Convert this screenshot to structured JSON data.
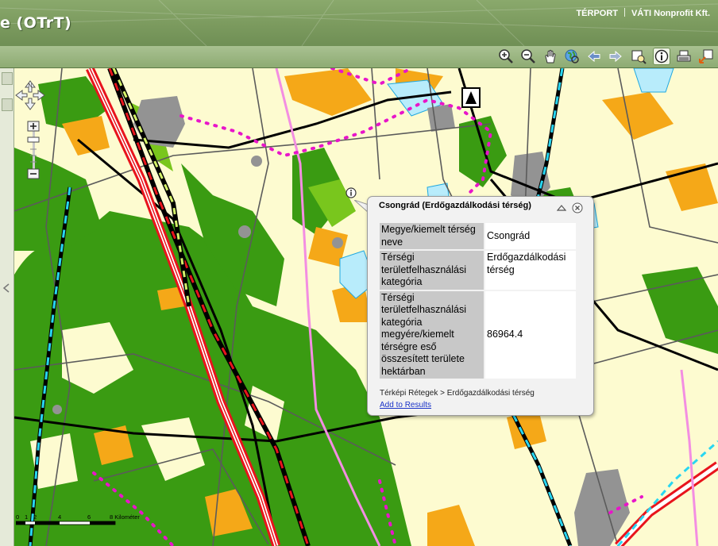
{
  "header": {
    "title": "e (OTrT)",
    "links": [
      "TÉRPORT",
      "VÁTI Nonprofit Kft."
    ]
  },
  "toolbar": {
    "tools": [
      "zoom-in-icon",
      "zoom-out-icon",
      "pan-hand-icon",
      "full-extent-globe-icon",
      "back-arrow-icon",
      "forward-arrow-icon",
      "zoom-to-selection-icon",
      "identify-info-icon",
      "print-map-icon",
      "overview-map-icon"
    ],
    "active_tool": "identify-info-icon"
  },
  "map": {
    "navigation": {
      "north_label": "N"
    },
    "scale_bar": {
      "ticks": [
        "0",
        "1",
        "2",
        "4",
        "6",
        "8 Kilométer"
      ]
    },
    "colors": {
      "background": "#fdfbd0",
      "forest": "#3a9b12",
      "light_forest": "#79c61d",
      "orange_zone": "#f5a818",
      "urban": "#939393",
      "water": "#b8ecfb",
      "road_main": "#000000",
      "road_secondary": "#5b5b5b",
      "highway": "#e8141c",
      "railway": "#000000",
      "border_dotted": "#e815c9",
      "bike_route": "#28d6f1",
      "pink_route": "#f38ee2"
    }
  },
  "popup": {
    "title": "Csongrád (Erdőgazdálkodási térség)",
    "rows": [
      {
        "key": "Megye/kiemelt térség neve",
        "value": "Csongrád"
      },
      {
        "key": "Térségi területfelhasználási kategória",
        "value": "Erdőgazdálkodási térség"
      },
      {
        "key": "Térségi területfelhasználási kategória megyére/kiemelt térségre eső összesített területe hektárban",
        "value": "86964.4"
      }
    ],
    "breadcrumb": "Térképi Rétegek > Erdőgazdálkodási térség",
    "link": "Add to Results"
  }
}
